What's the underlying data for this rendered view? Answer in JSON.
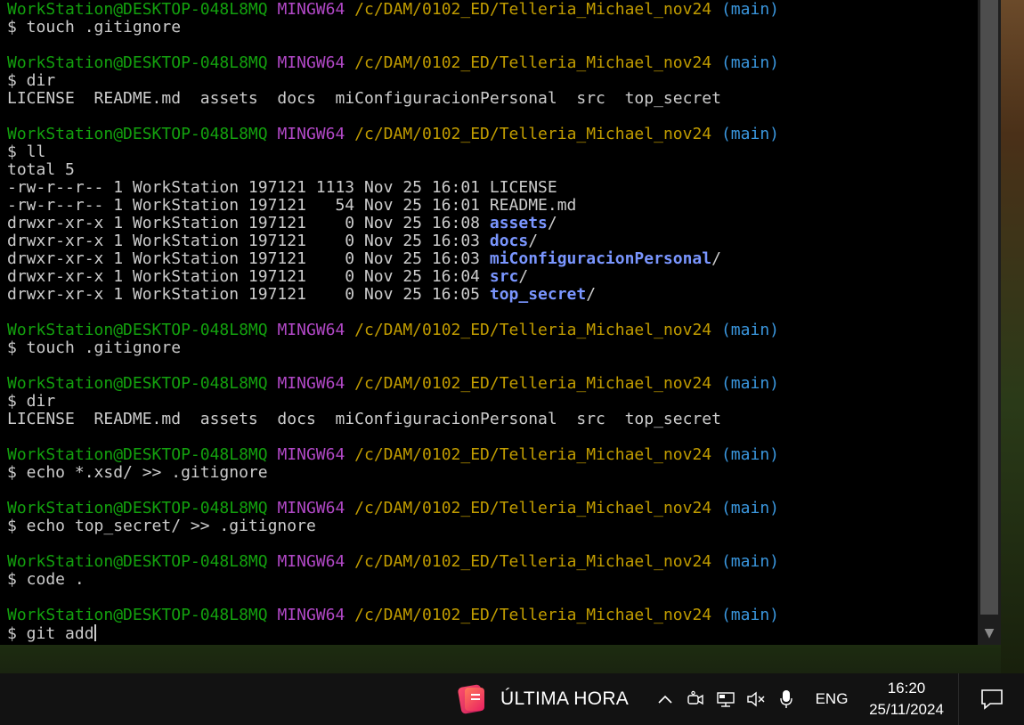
{
  "terminal": {
    "prompt": {
      "user_host": "WorkStation@DESKTOP-048L8MQ",
      "system": "MINGW64",
      "path": "/c/DAM/0102_ED/Telleria_Michael_nov24",
      "branch": "(main)"
    },
    "lines": [
      {
        "kind": "prompt"
      },
      {
        "kind": "cmd",
        "text": "$ touch .gitignore"
      },
      {
        "kind": "blank"
      },
      {
        "kind": "prompt"
      },
      {
        "kind": "cmd",
        "text": "$ dir"
      },
      {
        "kind": "out",
        "text": "LICENSE  README.md  assets  docs  miConfiguracionPersonal  src  top_secret"
      },
      {
        "kind": "blank"
      },
      {
        "kind": "prompt"
      },
      {
        "kind": "cmd",
        "text": "$ ll"
      },
      {
        "kind": "out",
        "text": "total 5"
      },
      {
        "kind": "out",
        "text": "-rw-r--r-- 1 WorkStation 197121 1113 Nov 25 16:01 LICENSE"
      },
      {
        "kind": "out",
        "text": "-rw-r--r-- 1 WorkStation 197121   54 Nov 25 16:01 README.md"
      },
      {
        "kind": "dir",
        "text": "drwxr-xr-x 1 WorkStation 197121    0 Nov 25 16:08 ",
        "name": "assets",
        "suffix": "/"
      },
      {
        "kind": "dir",
        "text": "drwxr-xr-x 1 WorkStation 197121    0 Nov 25 16:03 ",
        "name": "docs",
        "suffix": "/"
      },
      {
        "kind": "dir",
        "text": "drwxr-xr-x 1 WorkStation 197121    0 Nov 25 16:03 ",
        "name": "miConfiguracionPersonal",
        "suffix": "/"
      },
      {
        "kind": "dir",
        "text": "drwxr-xr-x 1 WorkStation 197121    0 Nov 25 16:04 ",
        "name": "src",
        "suffix": "/"
      },
      {
        "kind": "dir",
        "text": "drwxr-xr-x 1 WorkStation 197121    0 Nov 25 16:05 ",
        "name": "top_secret",
        "suffix": "/"
      },
      {
        "kind": "blank"
      },
      {
        "kind": "prompt"
      },
      {
        "kind": "cmd",
        "text": "$ touch .gitignore"
      },
      {
        "kind": "blank"
      },
      {
        "kind": "prompt"
      },
      {
        "kind": "cmd",
        "text": "$ dir"
      },
      {
        "kind": "out",
        "text": "LICENSE  README.md  assets  docs  miConfiguracionPersonal  src  top_secret"
      },
      {
        "kind": "blank"
      },
      {
        "kind": "prompt"
      },
      {
        "kind": "cmd",
        "text": "$ echo *.xsd/ >> .gitignore"
      },
      {
        "kind": "blank"
      },
      {
        "kind": "prompt"
      },
      {
        "kind": "cmd",
        "text": "$ echo top_secret/ >> .gitignore"
      },
      {
        "kind": "blank"
      },
      {
        "kind": "prompt"
      },
      {
        "kind": "cmd",
        "text": "$ code ."
      },
      {
        "kind": "blank"
      },
      {
        "kind": "prompt"
      },
      {
        "kind": "input",
        "text": "$ git add"
      }
    ],
    "colors": {
      "user_host": "#13a10e",
      "system": "#b148c6",
      "path": "#c19c00",
      "branch": "#3a96dd",
      "directory": "#7a96ff",
      "text": "#cccccc",
      "background": "#000000"
    }
  },
  "taskbar": {
    "news_label": "ÚLTIMA HORA",
    "tray_icons": [
      "chevron-up-icon",
      "meet-now-icon",
      "network-icon",
      "volume-muted-icon",
      "microphone-icon"
    ],
    "language": "ENG",
    "time": "16:20",
    "date": "25/11/2024"
  }
}
